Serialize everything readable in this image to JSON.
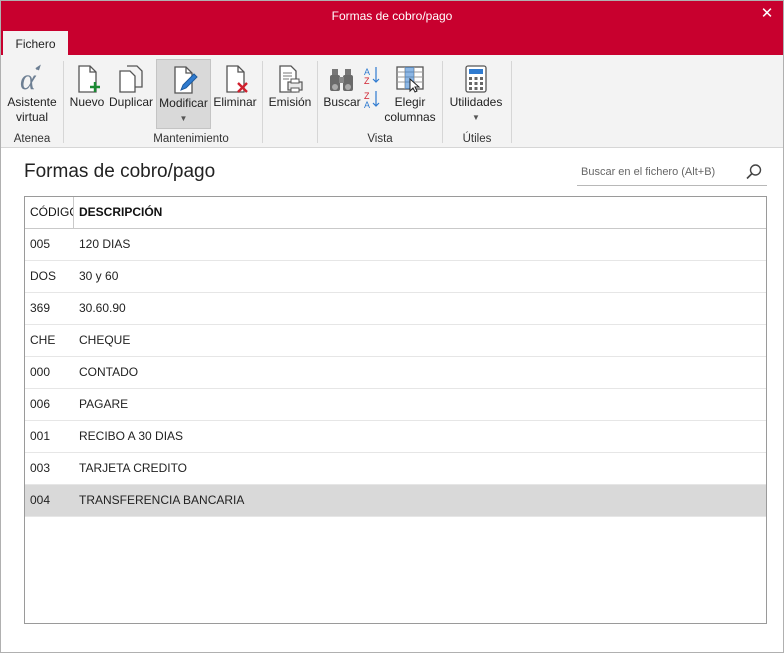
{
  "window": {
    "title": "Formas de cobro/pago"
  },
  "tabs": [
    {
      "label": "Fichero"
    }
  ],
  "ribbon": {
    "groups": [
      {
        "label": "Atenea"
      },
      {
        "label": "Mantenimiento"
      },
      {
        "label": "Vista"
      },
      {
        "label": "Útiles"
      }
    ],
    "buttons": {
      "asistente": {
        "line1": "Asistente",
        "line2": "virtual",
        "icon": "alpha-icon"
      },
      "nuevo": {
        "label": "Nuevo",
        "icon": "new-document-icon"
      },
      "duplicar": {
        "label": "Duplicar",
        "icon": "duplicate-icon"
      },
      "modificar": {
        "label": "Modificar",
        "icon": "edit-document-icon",
        "state": "selected"
      },
      "eliminar": {
        "label": "Eliminar",
        "icon": "delete-document-icon"
      },
      "emision": {
        "label": "Emisión",
        "icon": "print-icon"
      },
      "buscar": {
        "label": "Buscar",
        "icon": "binoculars-icon"
      },
      "sort": {
        "icon": "sort-az-icon"
      },
      "elegir": {
        "line1": "Elegir",
        "line2": "columnas",
        "icon": "columns-icon"
      },
      "utilidades": {
        "label": "Utilidades",
        "icon": "calculator-icon"
      }
    }
  },
  "main": {
    "heading": "Formas de cobro/pago",
    "search": {
      "placeholder": "Buscar en el fichero (Alt+B)",
      "value": ""
    }
  },
  "table": {
    "columns": [
      "CÓDIGO",
      "DESCRIPCIÓN"
    ],
    "rows": [
      {
        "code": "005",
        "description": "120 DIAS"
      },
      {
        "code": "DOS",
        "description": "30 y 60"
      },
      {
        "code": "369",
        "description": "30.60.90"
      },
      {
        "code": "CHE",
        "description": "CHEQUE"
      },
      {
        "code": "000",
        "description": "CONTADO"
      },
      {
        "code": "006",
        "description": "PAGARE"
      },
      {
        "code": "001",
        "description": "RECIBO A 30 DIAS"
      },
      {
        "code": "003",
        "description": "TARJETA CREDITO"
      },
      {
        "code": "004",
        "description": "TRANSFERENCIA BANCARIA",
        "selected": true
      }
    ]
  },
  "colors": {
    "accent": "#c8002e",
    "ribbon_bg": "#f3f3f3",
    "selected_row": "#d9d9d9"
  }
}
